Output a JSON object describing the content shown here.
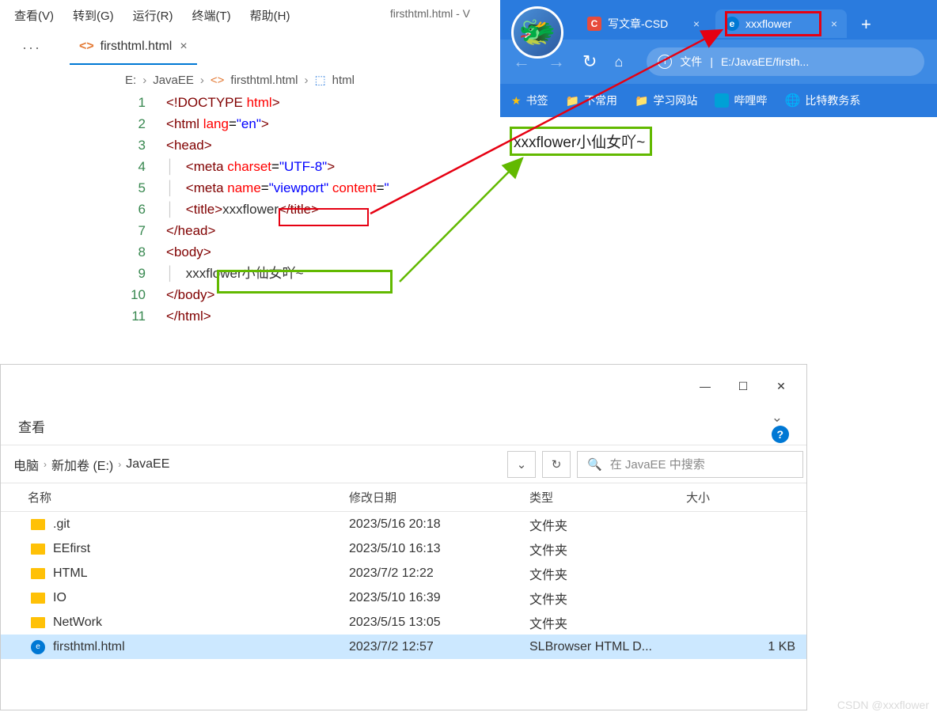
{
  "vscode": {
    "menu": [
      "查看(V)",
      "转到(G)",
      "运行(R)",
      "终端(T)",
      "帮助(H)"
    ],
    "title": "firsthtml.html - V",
    "tab": {
      "label": "firsthtml.html"
    },
    "breadcrumb": {
      "drive": "E:",
      "folder": "JavaEE",
      "file": "firsthtml.html",
      "el": "html"
    },
    "code": {
      "l1a": "<!",
      "l1b": "DOCTYPE",
      "l1c": " ",
      "l1d": "html",
      "l1e": ">",
      "l2a": "<",
      "l2b": "html",
      "l2c": " ",
      "l2d": "lang",
      "l2e": "=",
      "l2f": "\"en\"",
      "l2g": ">",
      "l3a": "<",
      "l3b": "head",
      "l3c": ">",
      "l4a": "<",
      "l4b": "meta",
      "l4c": " ",
      "l4d": "charset",
      "l4e": "=",
      "l4f": "\"UTF-8\"",
      "l4g": ">",
      "l5a": "<",
      "l5b": "meta",
      "l5c": " ",
      "l5d": "name",
      "l5e": "=",
      "l5f": "\"viewport\"",
      "l5g": " ",
      "l5h": "content",
      "l5i": "=",
      "l5j": "\"",
      "l6a": "<",
      "l6b": "title",
      "l6c": ">",
      "l6d": "xxxflower",
      "l6e": "</",
      "l6f": "title",
      "l6g": ">",
      "l7a": "</",
      "l7b": "head",
      "l7c": ">",
      "l8a": "<",
      "l8b": "body",
      "l8c": ">",
      "l9": "xxxflower小仙女吖~",
      "l10a": "</",
      "l10b": "body",
      "l10c": ">",
      "l11a": "</",
      "l11b": "html",
      "l11c": ">"
    },
    "linenums": [
      "1",
      "2",
      "3",
      "4",
      "5",
      "6",
      "7",
      "8",
      "9",
      "10",
      "11"
    ]
  },
  "browser": {
    "tabs": [
      {
        "icon": "C",
        "label": "写文章-CSD"
      },
      {
        "icon": "e",
        "label": "xxxflower"
      }
    ],
    "url": {
      "scheme": "文件",
      "path": "E:/JavaEE/firsth..."
    },
    "bookmarks": [
      "书签",
      "不常用",
      "学习网站",
      "哔哩哔",
      "比特教务系"
    ],
    "page_text": "xxxflower小仙女吖~"
  },
  "explorer": {
    "view_label": "查看",
    "path": [
      "电脑",
      "新加卷 (E:)",
      "JavaEE"
    ],
    "search_placeholder": "在 JavaEE 中搜索",
    "cols": {
      "name": "名称",
      "date": "修改日期",
      "type": "类型",
      "size": "大小"
    },
    "rows": [
      {
        "name": ".git",
        "date": "2023/5/16 20:18",
        "type": "文件夹",
        "size": "",
        "icon": "folder"
      },
      {
        "name": "EEfirst",
        "date": "2023/5/10 16:13",
        "type": "文件夹",
        "size": "",
        "icon": "folder"
      },
      {
        "name": "HTML",
        "date": "2023/7/2 12:22",
        "type": "文件夹",
        "size": "",
        "icon": "folder"
      },
      {
        "name": "IO",
        "date": "2023/5/10 16:39",
        "type": "文件夹",
        "size": "",
        "icon": "folder"
      },
      {
        "name": "NetWork",
        "date": "2023/5/15 13:05",
        "type": "文件夹",
        "size": "",
        "icon": "folder"
      },
      {
        "name": "firsthtml.html",
        "date": "2023/7/2 12:57",
        "type": "SLBrowser HTML D...",
        "size": "1 KB",
        "icon": "html",
        "selected": true
      }
    ]
  },
  "watermark": "CSDN @xxxflower"
}
